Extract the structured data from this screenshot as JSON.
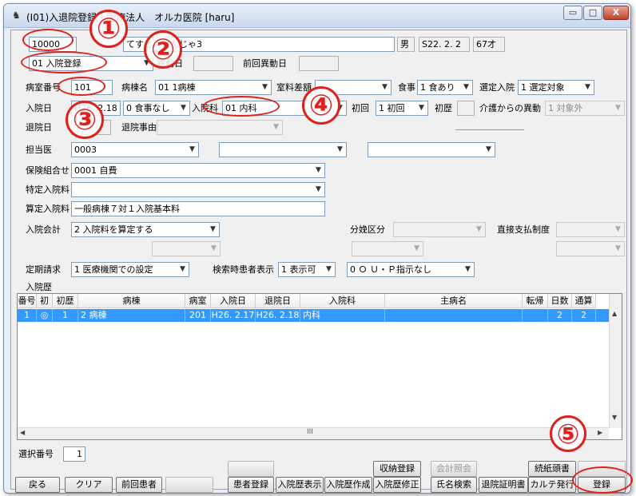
{
  "window": {
    "title": "(I01)入退院登録 - 医療法人　オルカ医院 [haru]",
    "min_btn": "▭",
    "max_btn": "□",
    "close_btn": "X"
  },
  "patient": {
    "id": "10000",
    "name": "てすと　かんじゃ3",
    "sex": "男",
    "birthdate": "S22. 2. 2",
    "age": "67才"
  },
  "mode": {
    "value": "01 入院登録",
    "change_date_label": "異動日",
    "change_date_value": "",
    "prev_change_label": "前回異動日",
    "prev_change_value": ""
  },
  "ward": {
    "room_label": "病室番号",
    "room_value": "101",
    "ward_label": "病棟名",
    "ward_value": "01 1病棟",
    "room_diff_label": "室料差額",
    "room_diff_value": "",
    "meal_label": "食事",
    "meal_value": "1 食あり",
    "selected_adm_label": "選定入院",
    "selected_adm_value": "1 選定対象"
  },
  "admission": {
    "date_label": "入院日",
    "date_value": "H26. 2.18",
    "meal_status": "0 食事なし",
    "dept_label": "入院科",
    "dept_value": "01 内科",
    "first_label": "初回",
    "first_value": "1 初回",
    "history_label": "初歴",
    "history_value": "",
    "care_transfer_label": "介護からの異動",
    "care_transfer_value": "1 対象外"
  },
  "discharge": {
    "date_label": "退院日",
    "date_value": "",
    "reason_label": "退院事由",
    "reason_value": ""
  },
  "doctor": {
    "label": "担当医",
    "value1": "0003",
    "value2": "",
    "value3": ""
  },
  "insurance": {
    "label": "保険組合せ",
    "value": "0001 自費"
  },
  "special_fee": {
    "label": "特定入院料",
    "value": ""
  },
  "calc_fee": {
    "label": "算定入院料",
    "value": "一般病棟７対１入院基本料"
  },
  "accounting": {
    "label": "入院会計",
    "value": "2 入院料を算定する",
    "delivery_label": "分娩区分",
    "delivery_value": "",
    "direct_pay_label": "直接支払制度",
    "direct_pay_value": ""
  },
  "regular": {
    "label": "定期請求",
    "value": "1 医療機関での設定",
    "search_label": "検索時患者表示",
    "search_value": "1 表示可",
    "ou_value": "0 Ｏ Ｕ・Ｐ指示なし"
  },
  "history": {
    "section_label": "入院歴",
    "columns": [
      "番号",
      "初",
      "初歴",
      "病棟",
      "病室",
      "入院日",
      "退院日",
      "入院科",
      "主病名",
      "転帰",
      "日数",
      "通算"
    ],
    "rows": [
      [
        "1",
        "◎",
        "1",
        "2 病棟",
        "201",
        "H26. 2.17",
        "H26. 2.18",
        "内科",
        "",
        "",
        "2",
        "2"
      ]
    ],
    "hscroll_mark": "III"
  },
  "selection": {
    "label": "選択番号",
    "value": "1"
  },
  "buttons": {
    "back": "戻る",
    "clear": "クリア",
    "prev_patient": "前回患者",
    "blank1": "",
    "blank_top": "",
    "patient_reg": "患者登録",
    "history_show": "入院歴表示",
    "history_create": "入院歴作成",
    "history_edit": "入院歴修正",
    "receipt_reg": "収納登録",
    "account_inquiry": "会計照会",
    "name_search": "氏名検索",
    "discharge_cert": "退院証明書",
    "chart_issue": "カルテ発行",
    "continue_sheet": "続紙頭書",
    "register": "登録"
  },
  "annotations": [
    "①",
    "②",
    "③",
    "④",
    "⑤"
  ]
}
